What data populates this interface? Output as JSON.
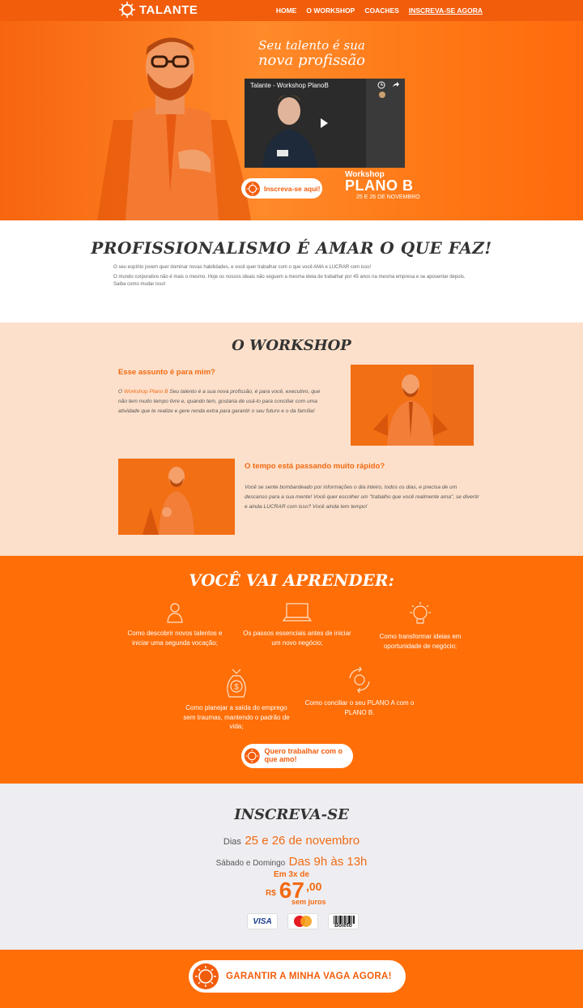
{
  "nav": {
    "logo_text": "TALANTE",
    "links": [
      "HOME",
      "O WORKSHOP",
      "COACHES",
      "INSCREVA-SE AGORA"
    ]
  },
  "hero": {
    "title_line1": "Seu talento é sua",
    "title_line2": "nova profissão",
    "video_title": "Talante - Workshop PlanoB",
    "cta_label": "Inscreva-se aqui!",
    "workshop_label": "Workshop",
    "plano_label": "PLANO B",
    "dates_label": "25 E 26 DE NOVEMBRO"
  },
  "profissionalismo": {
    "heading": "PROFISSIONALISMO É AMAR O QUE FAZ!",
    "p1": "O seu espírito jovem quer dominar novas habilidades, e você quer trabalhar com o que você AMA e LUCRAR com isso!",
    "p2": "O mundo corporativo não é mais o mesmo. Hoje os nossos ideais não seguem a mesma ideia de trabalhar por 45 anos na mesma empresa e se aposentar depois.",
    "p3": "Saiba como mudar isso!"
  },
  "workshop": {
    "heading": "O WORKSHOP",
    "q1": "Esse assunto é para mim?",
    "q1_highlight": "Workshop Plano B",
    "q1_text": " Seu talento é a sua nova profissão, é para você, executivo, que não tem muito tempo livre e, quando tem, gostaria de usá-lo para conciliar com uma atividade que te realize e gere renda extra para garantir o seu futuro e o da família!",
    "q1_prefix": "O ",
    "q2": "O tempo está passando muito rápido?",
    "q2_text": "Você se sente bombardeado por informações o dia inteiro, todos os dias, e precisa de um descanso para a sua mente! Você quer escolher um \"trabalho que você realmente ama\", se divertir e ainda LUCRAR com isso? Você ainda tem tempo!"
  },
  "aprender": {
    "heading": "VOCÊ VAI APRENDER:",
    "items": [
      {
        "text": "Como descobrir novos talentos e iniciar uma segunda vocação;",
        "icon": "person-icon"
      },
      {
        "text": "Os passos essenciais antes de iniciar um novo negócio;",
        "icon": "laptop-icon"
      },
      {
        "text": "Como transformar ideias em oportunidade de negócio;",
        "icon": "lightbulb-icon"
      },
      {
        "text": "Como planejar a saída do emprego sem traumas, mantendo o padrão de vida;",
        "icon": "money-bag-icon"
      },
      {
        "text": "Como conciliar o seu PLANO A com o PLANO B.",
        "icon": "cycle-arrows-icon"
      }
    ],
    "cta_label": "Quero trabalhar com o que amo!"
  },
  "inscreva": {
    "heading": "INSCREVA-SE",
    "dias_label": "Dias",
    "dias_value": "25 e 26 de novembro",
    "horario_label": "Sábado e Domingo",
    "horario_value": "Das 9h às 13h",
    "installments": "Em 3x de",
    "currency": "R$",
    "price_int": "67",
    "price_dec": ",00",
    "sem_juros": "sem juros",
    "payment_methods": [
      "VISA",
      "MasterCard",
      "Boleto"
    ]
  },
  "footer": {
    "cta_label": "GARANTIR A MINHA VAGA AGORA!"
  },
  "colors": {
    "brand_orange": "#f25d0c",
    "section_orange": "#ff6e07",
    "peach": "#fce0cb",
    "light_gray": "#eeeef2"
  }
}
